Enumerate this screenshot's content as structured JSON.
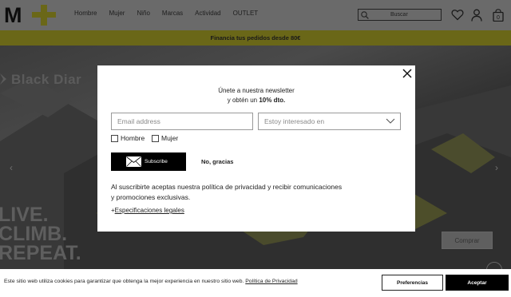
{
  "header": {
    "logo_text": "M+",
    "nav": [
      "Hombre",
      "Mujer",
      "Niño",
      "Marcas",
      "Actividad",
      "OUTLET"
    ],
    "search_placeholder": "Buscar",
    "cart_count": "0",
    "icons": [
      "search-icon",
      "heart-icon",
      "user-icon",
      "bag-icon"
    ]
  },
  "promo": {
    "text": "Financia tus pedidos desde 80€"
  },
  "hero": {
    "brand": "Black Diar",
    "slogan": [
      "LIVE.",
      "CLIMB.",
      "REPEAT."
    ],
    "cta": "Comprar",
    "prev": "‹",
    "next": "›"
  },
  "modal": {
    "title_line1": "Únete a nuestra newsletter",
    "title_line2_prefix": "y obtén un ",
    "title_line2_bold": "10% dto.",
    "email_placeholder": "Email address",
    "interest_placeholder": "Estoy interesado en",
    "checkbox_male": "Hombre",
    "checkbox_female": "Mujer",
    "subscribe": "Subscribe",
    "no_thanks": "No, gracias",
    "privacy_line1": "Al suscribirte aceptas nuestra política de privacidad y recibir comunicaciones",
    "privacy_line2": "y promociones exclusivas.",
    "legal_prefix": "+",
    "legal_link": "Especificaciones legales"
  },
  "cookie": {
    "text": "Este sitio web utiliza cookies para garantizar que obtenga la mejor experiencia en nuestro sitio web. ",
    "link": "Política de Privacidad",
    "preferences": "Preferencias",
    "accept": "Aceptar"
  },
  "colors": {
    "accent": "#f2e600",
    "overlay_dark": "#6a6a6a"
  }
}
